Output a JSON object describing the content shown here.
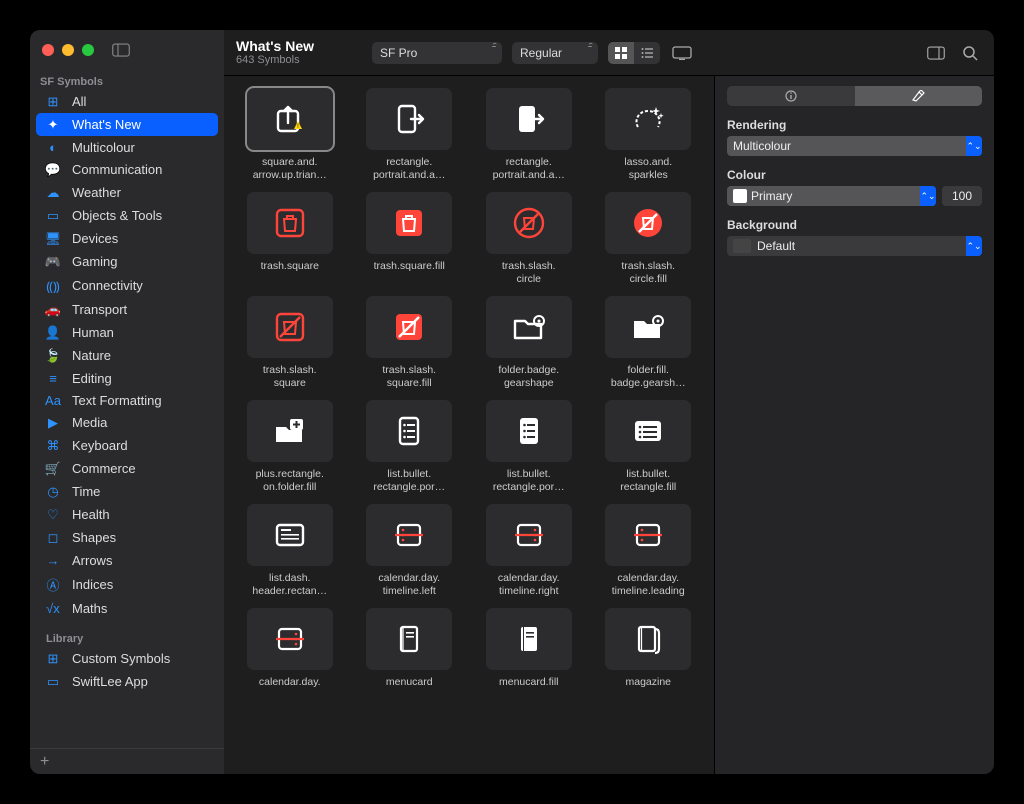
{
  "header": {
    "title": "What's New",
    "subtitle": "643 Symbols",
    "font_select": "SF Pro",
    "weight_select": "Regular"
  },
  "sidebar": {
    "section1": "SF Symbols",
    "section2": "Library",
    "items": [
      {
        "label": "All"
      },
      {
        "label": "What's New"
      },
      {
        "label": "Multicolour"
      },
      {
        "label": "Communication"
      },
      {
        "label": "Weather"
      },
      {
        "label": "Objects & Tools"
      },
      {
        "label": "Devices"
      },
      {
        "label": "Gaming"
      },
      {
        "label": "Connectivity"
      },
      {
        "label": "Transport"
      },
      {
        "label": "Human"
      },
      {
        "label": "Nature"
      },
      {
        "label": "Editing"
      },
      {
        "label": "Text Formatting"
      },
      {
        "label": "Media"
      },
      {
        "label": "Keyboard"
      },
      {
        "label": "Commerce"
      },
      {
        "label": "Time"
      },
      {
        "label": "Health"
      },
      {
        "label": "Shapes"
      },
      {
        "label": "Arrows"
      },
      {
        "label": "Indices"
      },
      {
        "label": "Maths"
      }
    ],
    "library": [
      {
        "label": "Custom Symbols"
      },
      {
        "label": "SwiftLee App"
      }
    ]
  },
  "symbols": [
    {
      "name": "square.and.\narrow.up.trian…"
    },
    {
      "name": "rectangle.\nportrait.and.a…"
    },
    {
      "name": "rectangle.\nportrait.and.a…"
    },
    {
      "name": "lasso.and.\nsparkles"
    },
    {
      "name": "trash.square"
    },
    {
      "name": "trash.square.fill"
    },
    {
      "name": "trash.slash.\ncircle"
    },
    {
      "name": "trash.slash.\ncircle.fill"
    },
    {
      "name": "trash.slash.\nsquare"
    },
    {
      "name": "trash.slash.\nsquare.fill"
    },
    {
      "name": "folder.badge.\ngearshape"
    },
    {
      "name": "folder.fill.\nbadge.gearsh…"
    },
    {
      "name": "plus.rectangle.\non.folder.fill"
    },
    {
      "name": "list.bullet.\nrectangle.por…"
    },
    {
      "name": "list.bullet.\nrectangle.por…"
    },
    {
      "name": "list.bullet.\nrectangle.fill"
    },
    {
      "name": "list.dash.\nheader.rectan…"
    },
    {
      "name": "calendar.day.\ntimeline.left"
    },
    {
      "name": "calendar.day.\ntimeline.right"
    },
    {
      "name": "calendar.day.\ntimeline.leading"
    },
    {
      "name": "calendar.day."
    },
    {
      "name": "menucard"
    },
    {
      "name": "menucard.fill"
    },
    {
      "name": "magazine"
    }
  ],
  "inspector": {
    "rendering_label": "Rendering",
    "rendering_value": "Multicolour",
    "colour_label": "Colour",
    "colour_value": "Primary",
    "opacity_value": "100",
    "background_label": "Background",
    "background_value": "Default"
  }
}
